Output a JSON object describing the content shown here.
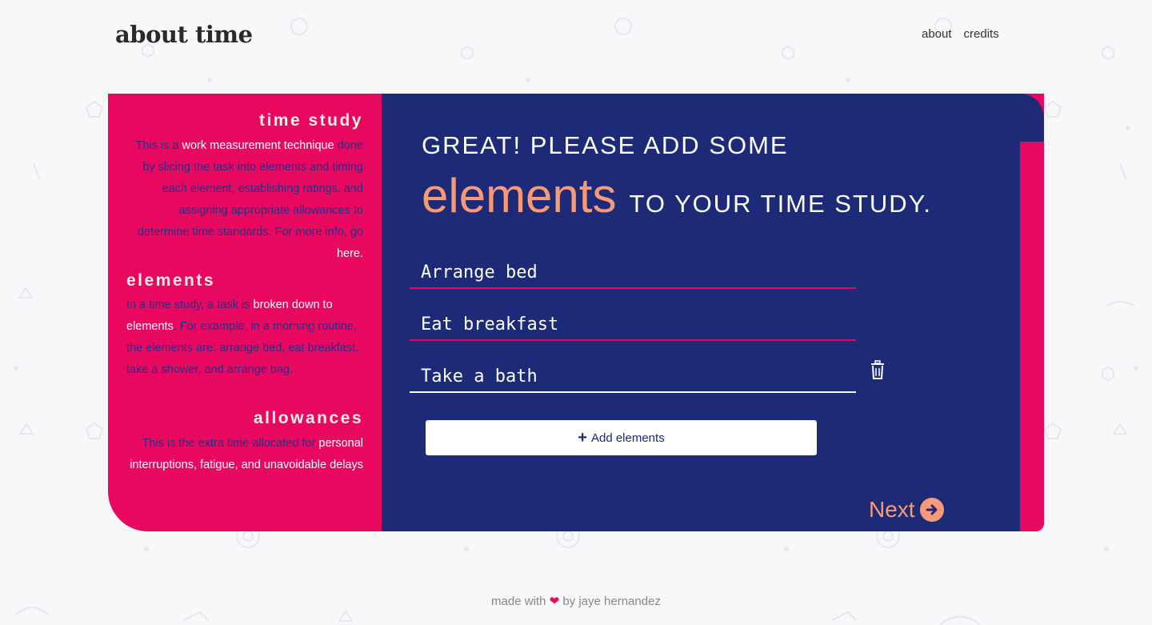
{
  "brand": {
    "title": "about time"
  },
  "nav": {
    "about": "about",
    "credits": "credits"
  },
  "sidebar": {
    "time_study": {
      "title": "time study",
      "text_1": "This is a ",
      "highlight_1": "work measurement technique",
      "text_2": " done by slicing the task into elements and timing each element, establishing ratings, and assigning appropriate allowances to determine time standards. For more info, go ",
      "link": "here."
    },
    "elements": {
      "title": "elements",
      "text_1": "In a time study, a task is ",
      "highlight_1": "broken down to elements",
      "text_2": ". For example, in a morning routine, the elements are: arrange bed, eat breakfast, take a shower, and arrange bag."
    },
    "allowances": {
      "title": "allowances",
      "text_1": "This is the extra time allocated for ",
      "highlight_1": "personal interruptions, fatigue, and unavoidable delays"
    }
  },
  "main": {
    "heading_line1": "GREAT! PLEASE ADD SOME",
    "heading_big": "elements",
    "heading_rest": "TO YOUR TIME STUDY.",
    "fields": [
      {
        "value": "Arrange bed"
      },
      {
        "value": "Eat breakfast"
      },
      {
        "value": "Take a bath"
      }
    ],
    "add_button": {
      "icon": "plus-icon",
      "label": "Add elements"
    },
    "next": {
      "label": "Next",
      "icon": "arrow-circle-right-icon"
    },
    "delete_icon": "trash-icon"
  },
  "footer": {
    "made_with": "made with",
    "by": "by jaye hernandez",
    "icon": "heart-icon"
  },
  "colors": {
    "pink": "#e8085f",
    "navy": "#1c2a78",
    "salmon": "#f89a78",
    "background": "#f7f8fa"
  }
}
